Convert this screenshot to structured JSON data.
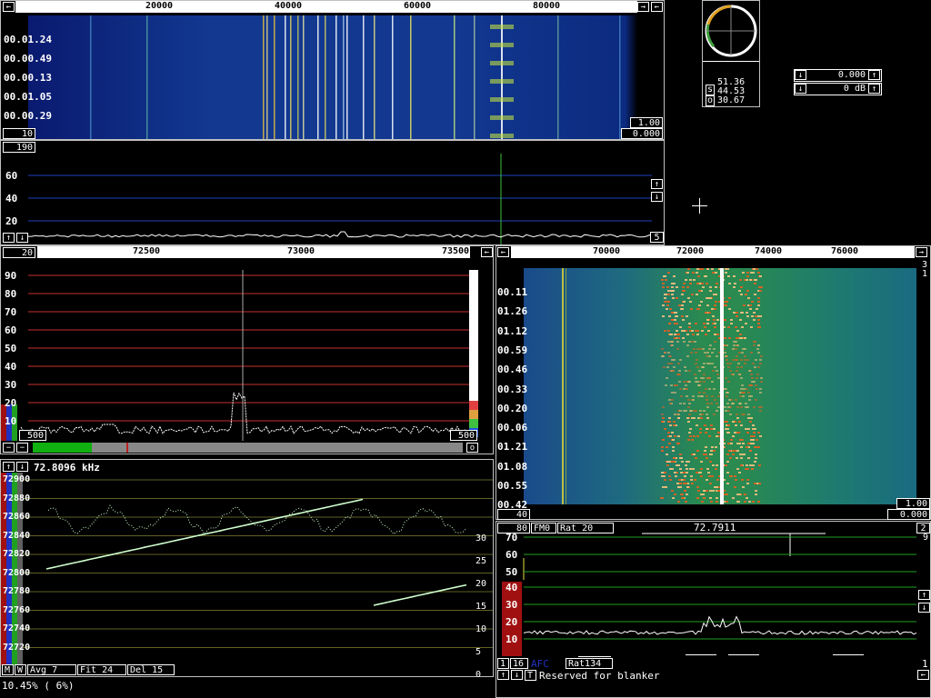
{
  "wide_waterfall": {
    "freq_ticks": [
      "20000",
      "40000",
      "60000",
      "80000"
    ],
    "time_labels": [
      "00.01.24",
      "00.00.49",
      "00.00.13",
      "00.01.05",
      "00.00.29"
    ],
    "gain_box": "10",
    "contrast_box": "1.00",
    "offset_box": "0.000",
    "avg_box": "190"
  },
  "wide_spectrum": {
    "y_ticks": [
      "60",
      "40",
      "20"
    ],
    "right_box": "5"
  },
  "meter": {
    "s_value": "51.36",
    "s2_value": "44.53",
    "o_value": "30.67",
    "s_label": "s",
    "o_label": "o"
  },
  "level_controls": {
    "value1": "0.000",
    "value2": "0 dB"
  },
  "high_res": {
    "avg_box": "20",
    "freq_ticks": [
      "72500",
      "73000",
      "73500"
    ],
    "y_ticks": [
      "90",
      "80",
      "70",
      "60",
      "50",
      "40",
      "30",
      "20",
      "10"
    ],
    "left_box": "500",
    "right_box": "500"
  },
  "freq_plot": {
    "title": "72.8096 kHz",
    "y_ticks": [
      "72900",
      "72880",
      "72860",
      "72840",
      "72820",
      "72800",
      "72780",
      "72760",
      "72740",
      "72720"
    ],
    "right_ticks": [
      "30",
      "25",
      "20",
      "15",
      "10",
      "5",
      "0"
    ],
    "mode_m": "M",
    "mode_w": "W",
    "avg": "Avg  7",
    "fit": "Fit 24",
    "del": "Del 15"
  },
  "baseband_waterfall": {
    "freq_ticks": [
      "70000",
      "72000",
      "74000",
      "76000"
    ],
    "time_labels": [
      "00.11",
      "01.26",
      "01.12",
      "00.59",
      "00.46",
      "00.33",
      "00.20",
      "00.06",
      "01.21",
      "01.08",
      "00.55",
      "00.42"
    ],
    "corner_top": "3",
    "corner_top2": "1",
    "gain_box": "40",
    "contrast_box": "1.00",
    "offset_box": "0.000"
  },
  "baseband_spectrum": {
    "box_80": "80",
    "fm_box": "FM0",
    "rat_box": "Rat 20",
    "freq": "72.7911",
    "right_box": "2",
    "right_num": "9",
    "y_ticks_top": [
      "70",
      "60",
      "50"
    ],
    "y_ticks_red": [
      "40",
      "30",
      "20",
      "10"
    ],
    "box_1": "1",
    "box_16": "16",
    "afc": "AFC",
    "rat134": "Rat134",
    "status_t": "T",
    "status_text": "Reserved for blanker",
    "corner_bottom": "1"
  },
  "footer": {
    "cpu": "10.45% ( 6%)"
  },
  "colors": {
    "grid_red": "#c83030",
    "grid_green": "#20a020",
    "grid_blue": "#2040c0",
    "trace_green": "#80ff80"
  }
}
